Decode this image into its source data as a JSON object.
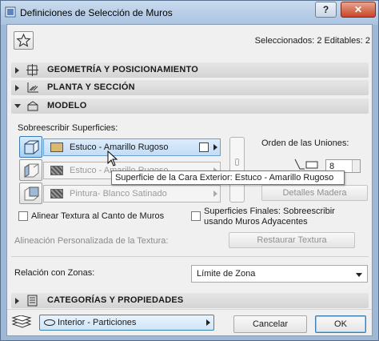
{
  "window": {
    "title": "Definiciones de Selección de Muros",
    "help_label": "?",
    "close_label": "✕"
  },
  "header": {
    "selection_count": "Seleccionados: 2 Editables: 2"
  },
  "sections": {
    "geometry": "GEOMETRÍA Y POSICIONAMIENTO",
    "plan": "PLANTA Y SECCIÓN",
    "model": "MODELO",
    "categories": "CATEGORÍAS Y PROPIEDADES"
  },
  "model": {
    "override_label": "Sobreescribir Superficies:",
    "materials": [
      {
        "name": "Estuco - Amarillo Rugoso",
        "color": "#d9b871"
      },
      {
        "name": "Estuco - Amarillo Rugoso"
      },
      {
        "name": "Pintura- Blanco Satinado"
      }
    ],
    "tooltip": "Superficie de la Cara Exterior: Estuco - Amarillo Rugoso",
    "join_order_label": "Orden de las Uniones:",
    "join_order_value": "8",
    "wood_details_button": "Detalles Madera",
    "align_texture_label": "Alinear Textura al Canto de Muros",
    "final_surfaces_line1": "Superficies Finales: Sobreescribir",
    "final_surfaces_line2": "usando Muros Adyacentes",
    "custom_alignment_label": "Alineación Personalizada de la Textura:",
    "restore_texture_button": "Restaurar Textura",
    "zone_relation_label": "Relación con Zonas:",
    "zone_relation_value": "Límite de Zona"
  },
  "footer": {
    "layer_value": "Interior - Particiones",
    "cancel_label": "Cancelar",
    "ok_label": "OK"
  },
  "colors": {
    "accent": "#3c7fb1",
    "title_bar": "#b9cfe8",
    "close_button": "#c7442a"
  }
}
